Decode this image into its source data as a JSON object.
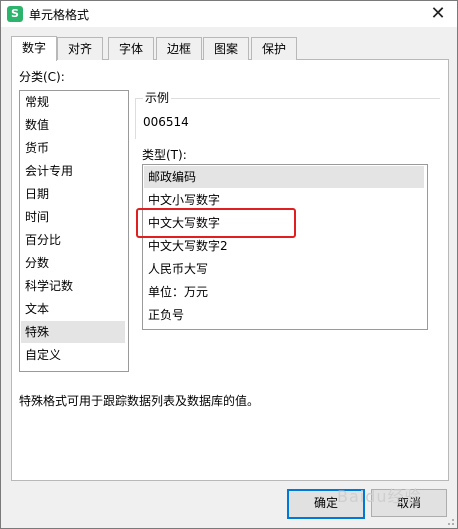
{
  "window": {
    "title": "单元格格式",
    "app_icon": "S"
  },
  "tabs": [
    {
      "label": "数字",
      "active": true
    },
    {
      "label": "对齐",
      "active": false
    },
    {
      "label": "字体",
      "active": false
    },
    {
      "label": "边框",
      "active": false
    },
    {
      "label": "图案",
      "active": false
    },
    {
      "label": "保护",
      "active": false
    }
  ],
  "category": {
    "label": "分类(C):",
    "items": [
      "常规",
      "数值",
      "货币",
      "会计专用",
      "日期",
      "时间",
      "百分比",
      "分数",
      "科学记数",
      "文本",
      "特殊",
      "自定义"
    ],
    "selected": "特殊"
  },
  "sample": {
    "legend": "示例",
    "value": "006514"
  },
  "type": {
    "label": "类型(T):",
    "items": [
      "邮政编码",
      "中文小写数字",
      "中文大写数字",
      "中文大写数字2",
      "人民币大写",
      "单位：万元",
      "正负号"
    ],
    "selected": "邮政编码",
    "highlighted": "中文大写数字",
    "highlight_color": "#e02020"
  },
  "description": "特殊格式可用于跟踪数据列表及数据库的值。",
  "buttons": {
    "ok": "确定",
    "cancel": "取消"
  },
  "watermark": "Baidu经验",
  "colors": {
    "accent": "#0078d7",
    "app_icon": "#2db46c"
  }
}
